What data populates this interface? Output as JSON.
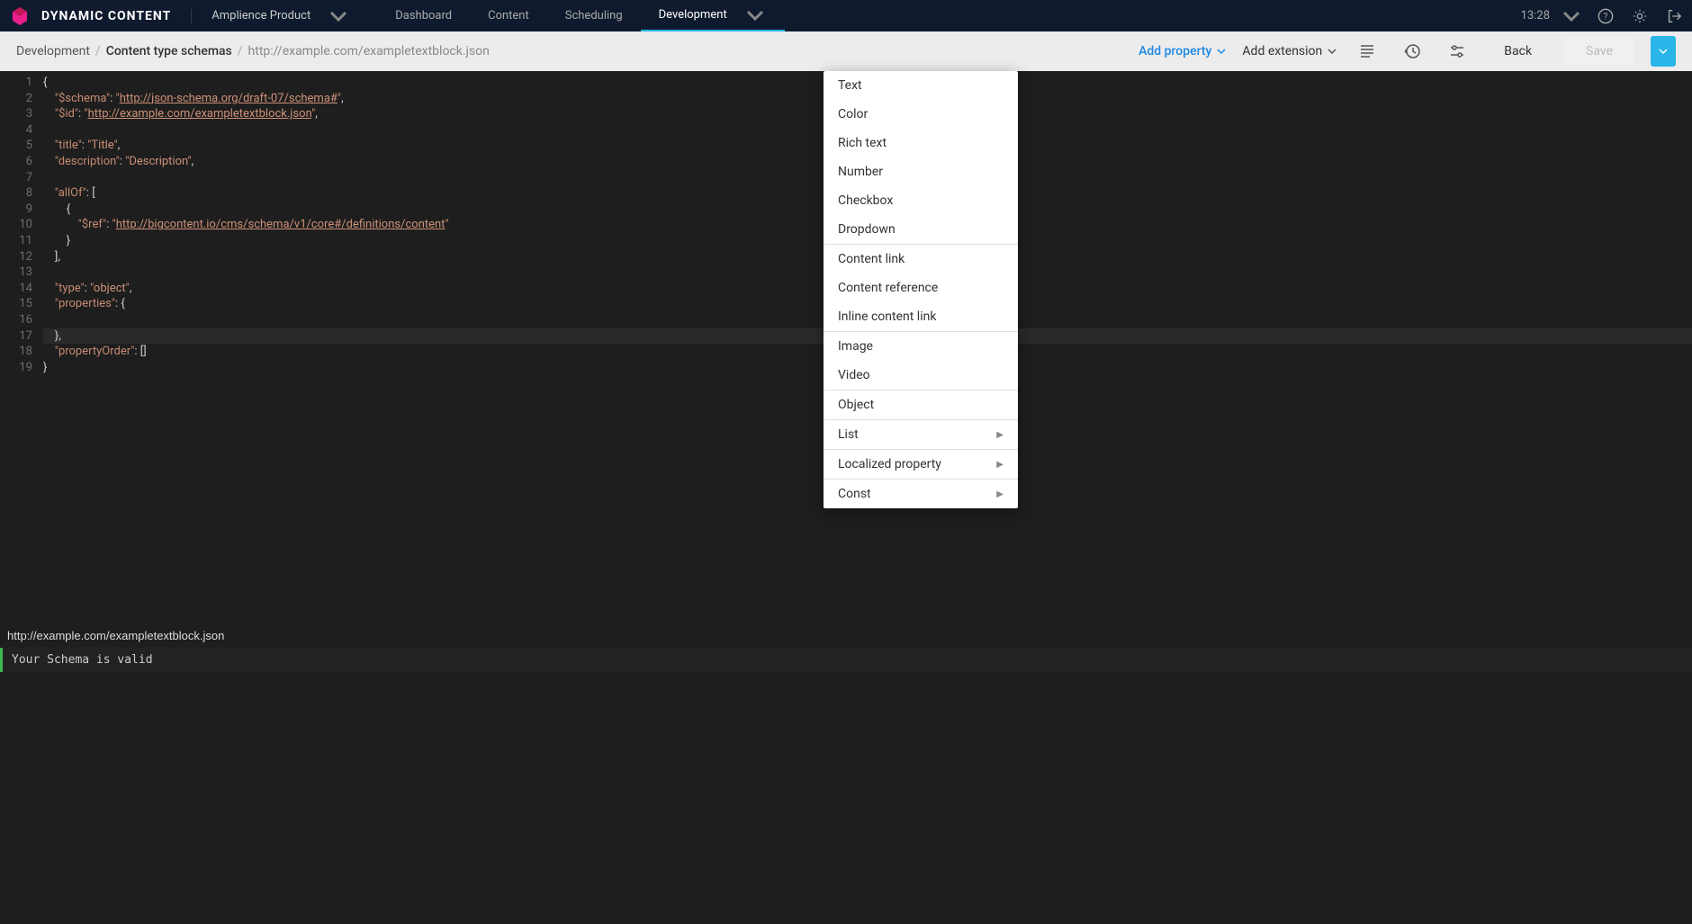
{
  "brand": "DYNAMIC CONTENT",
  "hub": "Amplience Product",
  "nav": [
    "Dashboard",
    "Content",
    "Scheduling",
    "Development"
  ],
  "time": "13:28",
  "breadcrumb": {
    "a": "Development",
    "b": "Content type schemas",
    "c": "http://example.com/exampletextblock.json"
  },
  "toolbar": {
    "addprop": "Add property",
    "addext": "Add extension",
    "back": "Back",
    "save": "Save"
  },
  "dropdown": {
    "g1": [
      "Text",
      "Color",
      "Rich text",
      "Number",
      "Checkbox",
      "Dropdown"
    ],
    "g2": [
      "Content link",
      "Content reference",
      "Inline content link"
    ],
    "g3": [
      "Image",
      "Video"
    ],
    "g4": [
      "Object"
    ],
    "g5": [
      "List",
      "Localized property",
      "Const"
    ]
  },
  "code": {
    "lines": 19,
    "schema_val": "http://json-schema.org/draft-07/schema#",
    "id_val": "http://example.com/exampletextblock.json",
    "title_val": "Title",
    "desc_val": "Description",
    "ref_val": "http://bigcontent.io/cms/schema/v1/core#/definitions/content",
    "type_val": "object"
  },
  "footer": {
    "url": "http://example.com/exampletextblock.json",
    "status": "Your Schema is valid"
  }
}
